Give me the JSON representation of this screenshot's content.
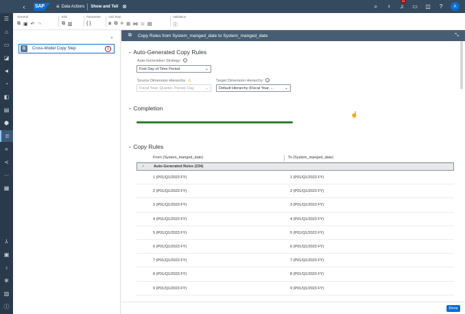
{
  "shell": {
    "back_icon": "back-arrow-icon",
    "logo": "SAP",
    "app_title": "Data Actions",
    "story_title": "Show and Tell",
    "notification_count": "31",
    "avatar_letter": "A"
  },
  "toolbar": {
    "groups": {
      "general": "General",
      "edit": "Edit",
      "parameter": "Parameter",
      "add_step": "Add Step",
      "validation": "Validation"
    },
    "parameter_glyph": "{ }"
  },
  "left_pane": {
    "step_label": "Cross-Model Copy Step",
    "step_warning": "!"
  },
  "dialog": {
    "title": "Copy Rules from System_manged_date to System_manged_date",
    "auto_section": {
      "title": "Auto-Generated Copy Rules",
      "strategy_label": "Auto-Generation Strategy:",
      "strategy_value": "First Day of Time Period",
      "source_label": "Source Dimension Hierarchy:",
      "source_value": "Fiscal Year, Quarter, Period, Day",
      "target_label": "Target Dimension Hierarchy:",
      "target_value": "Default Hierarchy (Fiscal Year, ..."
    },
    "completion": {
      "title": "Completion",
      "progress_percent": 100
    },
    "copy_rules": {
      "title": "Copy Rules",
      "col_from": "From (System_manged_date)",
      "col_to": "To (System_manged_date)",
      "group_label": "Auto-Generated Rules (334)",
      "rows": [
        {
          "from": "1 (P01/Q1/2023 FY)",
          "to": "1 (P01/Q1/2023 FY)"
        },
        {
          "from": "2 (P01/Q1/2023 FY)",
          "to": "2 (P01/Q1/2023 FY)"
        },
        {
          "from": "3 (P01/Q1/2023 FY)",
          "to": "3 (P01/Q1/2023 FY)"
        },
        {
          "from": "4 (P01/Q1/2023 FY)",
          "to": "4 (P01/Q1/2023 FY)"
        },
        {
          "from": "5 (P01/Q1/2023 FY)",
          "to": "5 (P01/Q1/2023 FY)"
        },
        {
          "from": "6 (P01/Q1/2023 FY)",
          "to": "6 (P01/Q1/2023 FY)"
        },
        {
          "from": "7 (P01/Q1/2023 FY)",
          "to": "7 (P01/Q1/2023 FY)"
        },
        {
          "from": "8 (P01/Q1/2023 FY)",
          "to": "8 (P01/Q1/2023 FY)"
        },
        {
          "from": "9 (P01/Q1/2023 FY)",
          "to": "9 (P01/Q1/2023 FY)"
        }
      ]
    },
    "done_label": "Done"
  },
  "colors": {
    "shell_bg": "#354a5f",
    "dialog_header_bg": "#475d73",
    "progress_fill": "#2b7d2b",
    "accent": "#0a6ed1"
  }
}
